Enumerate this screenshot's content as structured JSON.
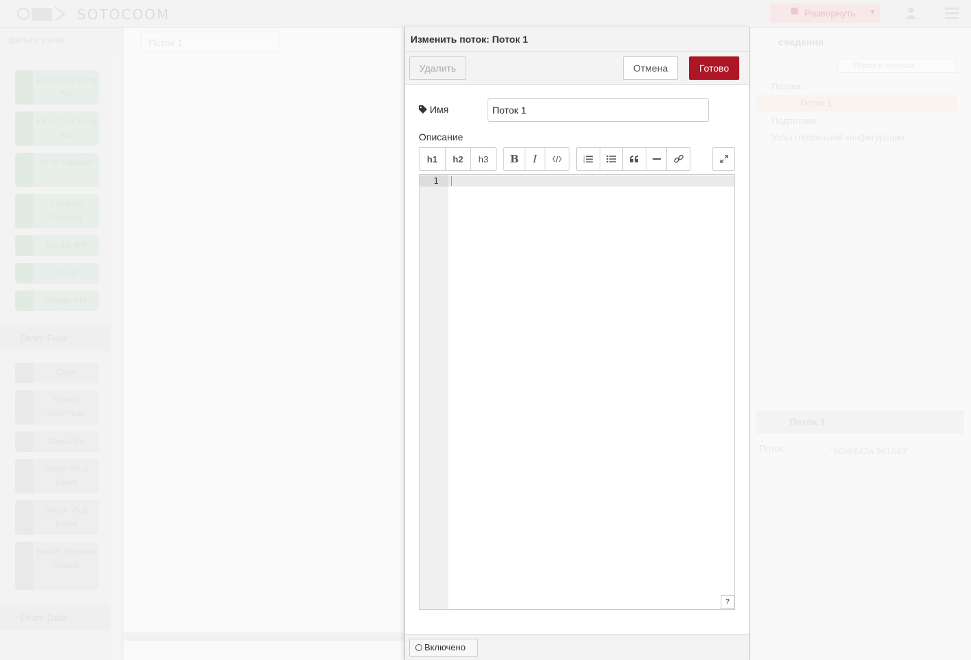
{
  "background": {
    "logo_text": "SOTOCOOM",
    "deploy_label": "Развернуть",
    "palette_search": "фильтр узлов",
    "palette_nodes_top": [
      "VK to User Long Poll",
      "VK to Chat Long Poll",
      "VK to Callback",
      "Telegram Receiver",
      "Sender MR",
      "VK Api",
      "Google API"
    ],
    "palette_category_1": "Drom Flow",
    "palette_nodes_flow": [
      "Case",
      "Switch Date/Time",
      "Stress Str",
      "Switch VK & Event",
      "Switch Vk & Event",
      "Switch Telegram Update"
    ],
    "palette_category_2": "Drom Data",
    "workspace_tab": "Поток 1",
    "sidebar_tab": "сведения",
    "sidebar_search": "Поиск в потоках",
    "sidebar_tree": [
      "Потоки",
      "Подпотоки",
      "Узлы глобальной конфигурации"
    ],
    "sidebar_flow_item": "Поток 1",
    "sidebar_info_title": "Поток 1",
    "sidebar_prop_key": "Поток",
    "sidebar_prop_value": "\"e0bb842a.961848\""
  },
  "tray": {
    "title": "Изменить поток: Поток 1",
    "delete_label": "Удалить",
    "cancel_label": "Отмена",
    "done_label": "Готово",
    "name_label": "Имя",
    "name_value": "Поток 1",
    "description_label": "Описание",
    "toolbar": {
      "h1": "h1",
      "h2": "h2",
      "h3": "h3",
      "bold": "B",
      "italic": "I"
    },
    "editor": {
      "line_number": "1",
      "help": "?"
    },
    "enabled_label": "Включено"
  },
  "colors": {
    "accent": "#ad1625",
    "panel_bg": "#f3f3f3",
    "border": "#cccccc"
  }
}
